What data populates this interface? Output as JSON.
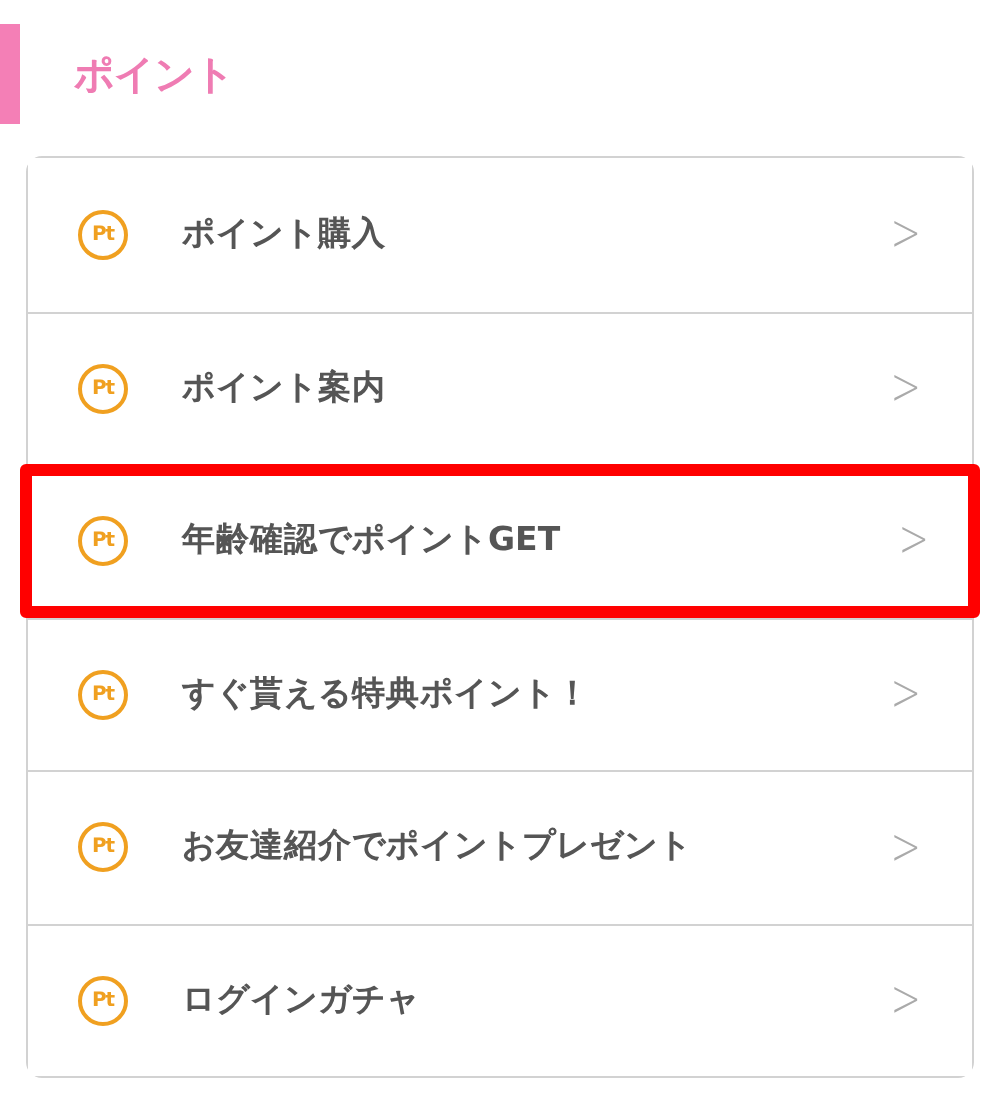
{
  "section": {
    "title": "ポイント"
  },
  "items": [
    {
      "icon_text": "Pt",
      "label": "ポイント購入",
      "chevron": ">",
      "highlighted": false
    },
    {
      "icon_text": "Pt",
      "label": "ポイント案内",
      "chevron": ">",
      "highlighted": false
    },
    {
      "icon_text": "Pt",
      "label": "年齢確認でポイントGET",
      "chevron": ">",
      "highlighted": true
    },
    {
      "icon_text": "Pt",
      "label": "すぐ貰える特典ポイント！",
      "chevron": ">",
      "highlighted": false
    },
    {
      "icon_text": "Pt",
      "label": "お友達紹介でポイントプレゼント",
      "chevron": ">",
      "highlighted": false
    },
    {
      "icon_text": "Pt",
      "label": "ログインガチャ",
      "chevron": ">",
      "highlighted": false
    }
  ]
}
